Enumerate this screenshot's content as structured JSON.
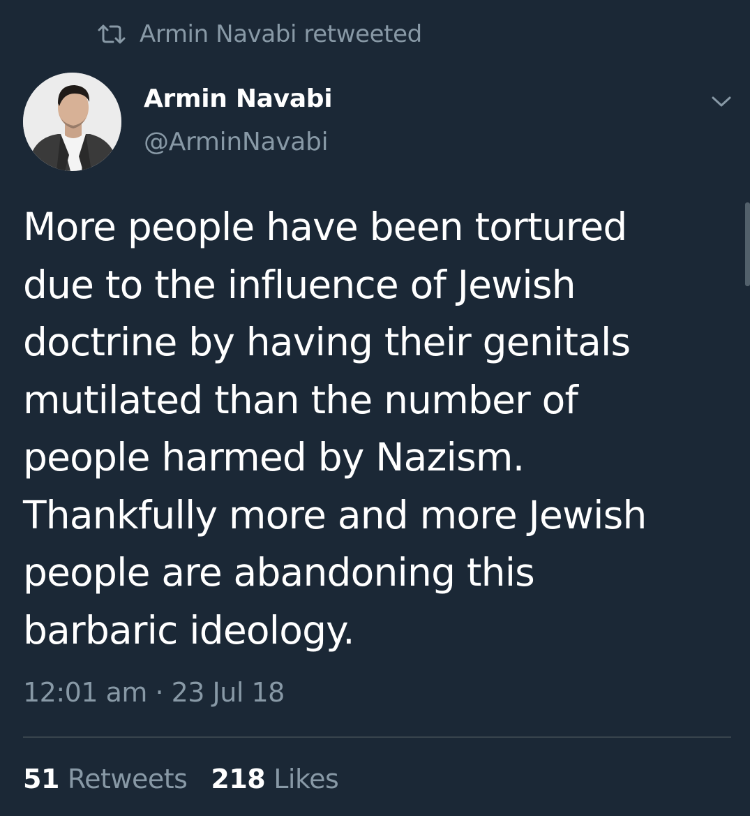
{
  "retweet_context": {
    "icon": "retweet-icon",
    "text": "Armin Navabi retweeted"
  },
  "author": {
    "name": "Armin Navabi",
    "handle": "@ArminNavabi",
    "avatar": "avatar-photo"
  },
  "tweet": {
    "text": "More people have been tortured\ndue to the influence of Jewish\ndoctrine by having their genitals\nmutilated than the number of\npeople harmed by Nazism.\nThankfully more and more Jewish\npeople are abandoning this\nbarbaric ideology.",
    "timestamp": "12:01 am · 23 Jul 18"
  },
  "menu": {
    "icon": "chevron-down-icon"
  },
  "stats": {
    "retweets_count": "51",
    "retweets_label": "Retweets",
    "likes_count": "218",
    "likes_label": "Likes"
  },
  "colors": {
    "background": "#1b2836",
    "primary_text": "#ffffff",
    "secondary_text": "#8899a6",
    "divider": "#38444d"
  }
}
